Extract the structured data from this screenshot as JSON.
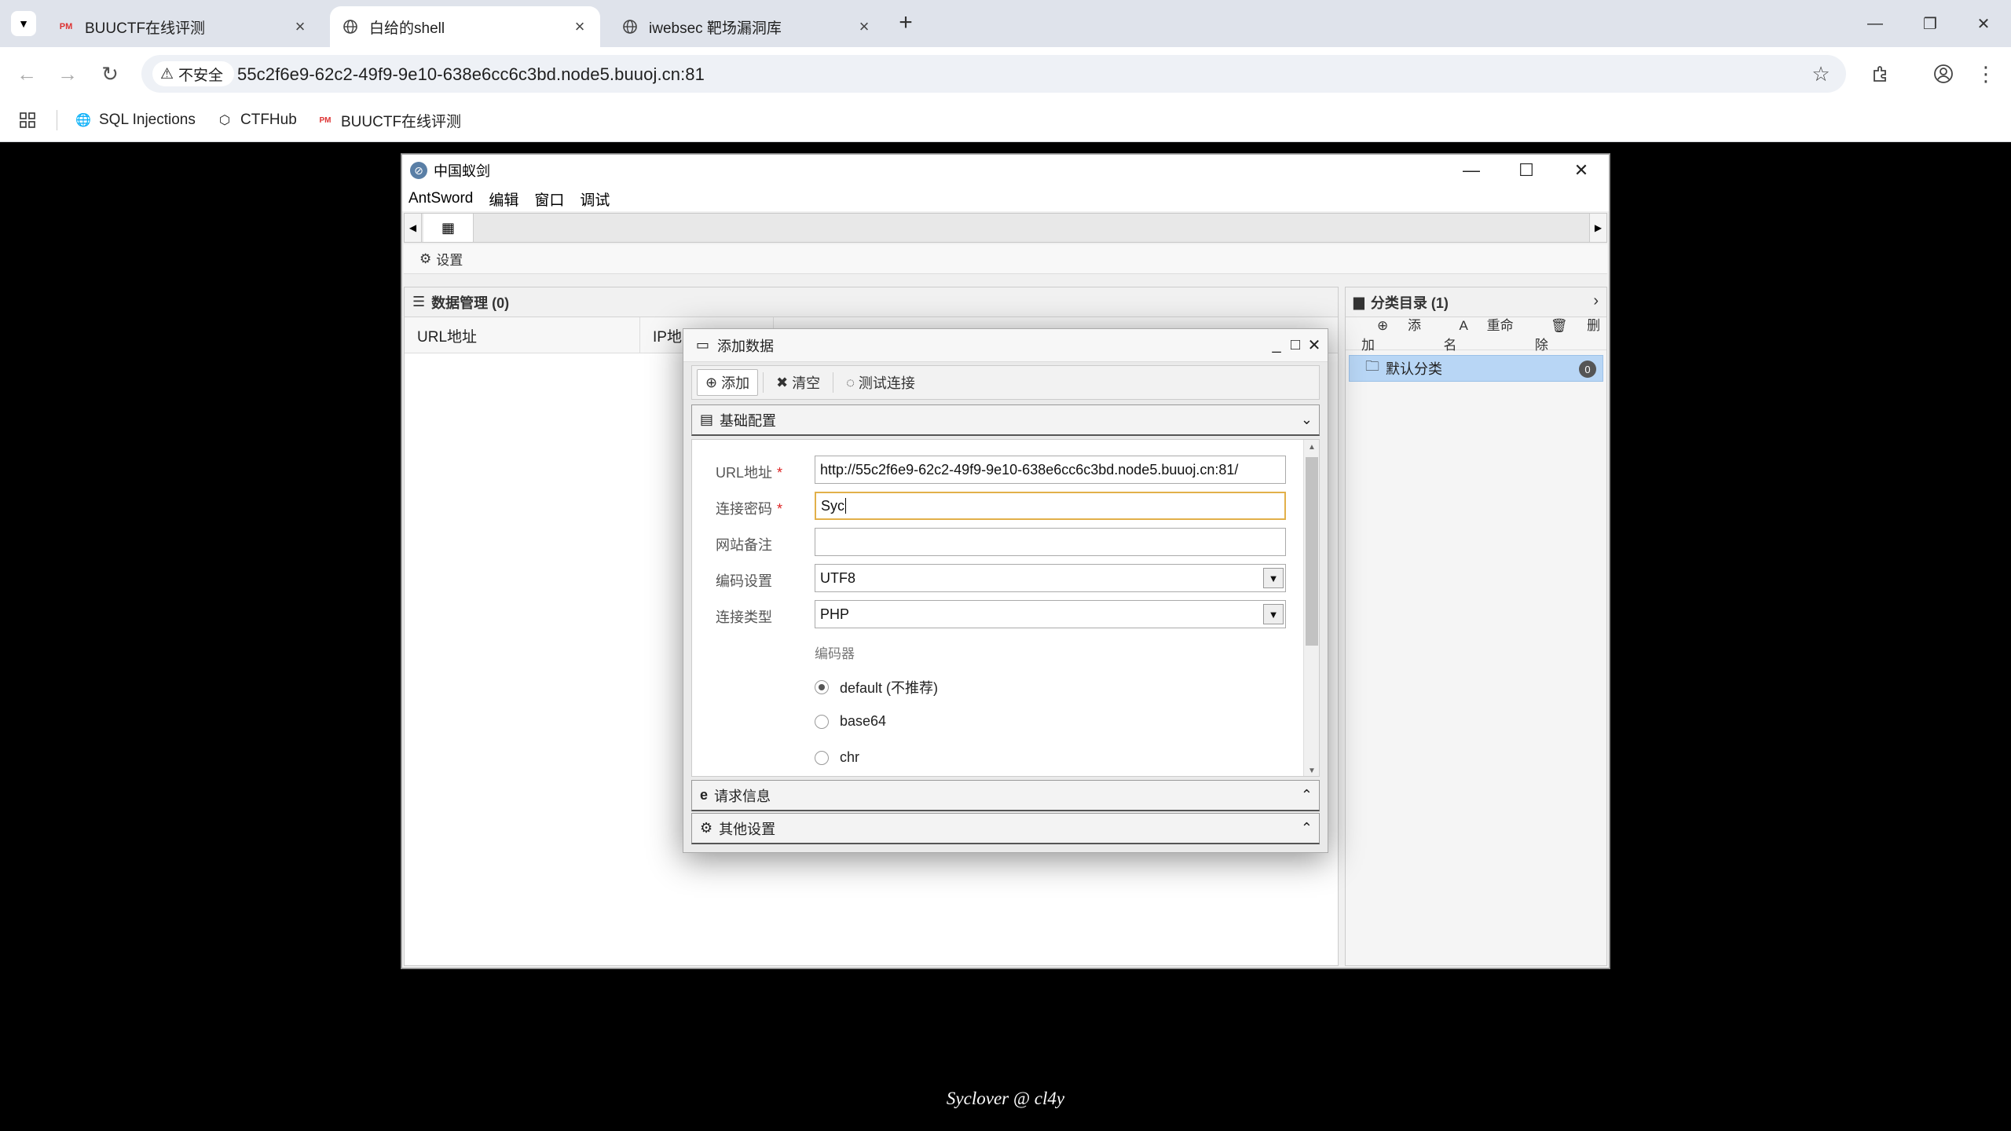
{
  "browser": {
    "tabs": [
      {
        "title": "BUUCTF在线评测",
        "active": false
      },
      {
        "title": "白给的shell",
        "active": true
      },
      {
        "title": "iwebsec 靶场漏洞库",
        "active": false
      }
    ],
    "security_label": "不安全",
    "url": "55c2f6e9-62c2-49f9-9e10-638e6cc6c3bd.node5.buuoj.cn:81",
    "bookmarks": [
      "SQL Injections",
      "CTFHub",
      "BUUCTF在线评测"
    ]
  },
  "antsword": {
    "window_title": "中国蚁剑",
    "menu": [
      "AntSword",
      "编辑",
      "窗口",
      "调试"
    ],
    "settings_label": "设置",
    "data_panel": {
      "title": "数据管理 (0)",
      "columns": [
        "URL地址",
        "IP地"
      ]
    },
    "category_panel": {
      "title": "分类目录 (1)",
      "add": "添加",
      "rename": "重命名",
      "delete": "删除",
      "default_category": "默认分类",
      "default_count": "0"
    },
    "modal": {
      "title": "添加数据",
      "toolbar": {
        "add": "添加",
        "clear": "清空",
        "test": "测试连接"
      },
      "section_basic": "基础配置",
      "section_request": "请求信息",
      "section_other": "其他设置",
      "fields": {
        "url_label": "URL地址",
        "url_value": "http://55c2f6e9-62c2-49f9-9e10-638e6cc6c3bd.node5.buuoj.cn:81/",
        "password_label": "连接密码",
        "password_value": "Syc",
        "note_label": "网站备注",
        "note_value": "",
        "encoding_label": "编码设置",
        "encoding_value": "UTF8",
        "type_label": "连接类型",
        "type_value": "PHP",
        "encoder_label": "编码器",
        "encoders": [
          {
            "label": "default (不推荐)",
            "selected": true
          },
          {
            "label": "base64",
            "selected": false
          },
          {
            "label": "chr",
            "selected": false
          }
        ]
      }
    }
  },
  "footer": "Syclover @ cl4y"
}
